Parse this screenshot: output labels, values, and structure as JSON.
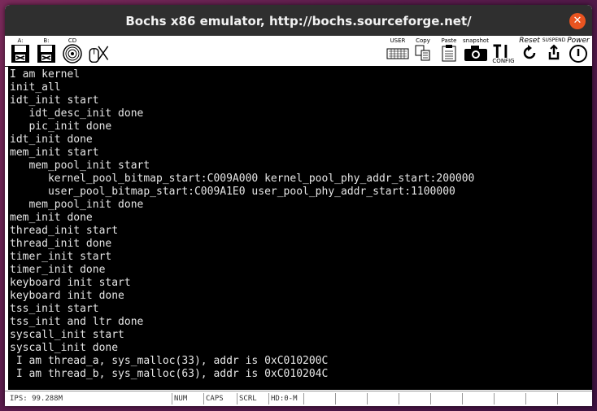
{
  "window": {
    "title": "Bochs x86 emulator, http://bochs.sourceforge.net/",
    "close_glyph": "✕"
  },
  "toolbar": {
    "floppy_a": "A:",
    "floppy_b": "B:",
    "cdrom": "CD",
    "user": "USER",
    "copy": "Copy",
    "paste": "Paste",
    "snapshot": "snapshot",
    "config": "CONFIG",
    "reset": "Reset",
    "suspend": "SUSPEND",
    "power": "Power"
  },
  "console": {
    "lines": [
      "I am kernel",
      "init_all",
      "idt_init start",
      "   idt_desc_init done",
      "   pic_init done",
      "idt_init done",
      "mem_init start",
      "   mem_pool_init start",
      "      kernel_pool_bitmap_start:C009A000 kernel_pool_phy_addr_start:200000",
      "      user_pool_bitmap_start:C009A1E0 user_pool_phy_addr_start:1100000",
      "   mem_pool_init done",
      "mem_init done",
      "thread_init start",
      "thread_init done",
      "timer_init start",
      "timer_init done",
      "keyboard init start",
      "keyboard init done",
      "tss_init start",
      "tss_init and ltr done",
      "syscall_init start",
      "syscall_init done",
      " I am thread_a, sys_malloc(33), addr is 0xC010200C",
      " I am thread_b, sys_malloc(63), addr is 0xC010204C"
    ]
  },
  "status": {
    "ips": "IPS: 99.288M",
    "num": "NUM",
    "caps": "CAPS",
    "scrl": "SCRL",
    "hd": "HD:0-M"
  }
}
